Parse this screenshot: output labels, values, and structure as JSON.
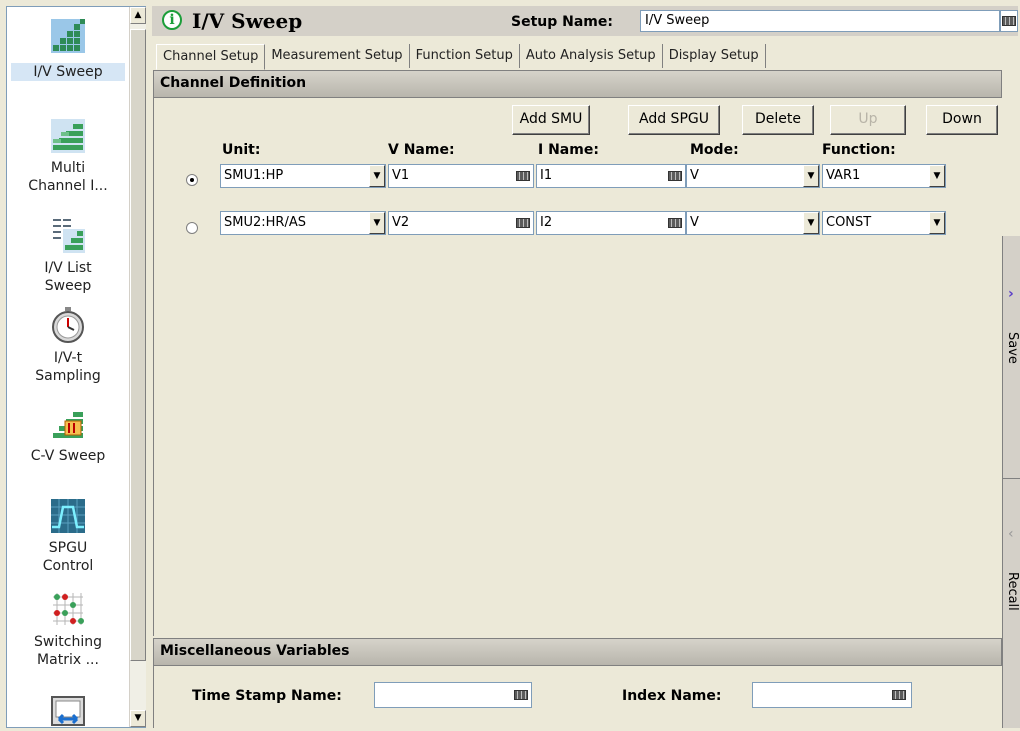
{
  "sidebar": {
    "items": [
      {
        "label_line1": "I/V Sweep",
        "label_line2": "",
        "icon": "iv-sweep-icon"
      },
      {
        "label_line1": "Multi",
        "label_line2": "Channel I...",
        "icon": "multi-channel-icon"
      },
      {
        "label_line1": "I/V List",
        "label_line2": "Sweep",
        "icon": "list-sweep-icon"
      },
      {
        "label_line1": "I/V-t",
        "label_line2": "Sampling",
        "icon": "stopwatch-icon"
      },
      {
        "label_line1": "C-V Sweep",
        "label_line2": "",
        "icon": "cv-sweep-icon"
      },
      {
        "label_line1": "SPGU",
        "label_line2": "Control",
        "icon": "spgu-icon"
      },
      {
        "label_line1": "Switching",
        "label_line2": "Matrix ...",
        "icon": "switching-matrix-icon"
      }
    ]
  },
  "header": {
    "title": "I/V Sweep",
    "setup_name_label": "Setup Name:",
    "setup_name_value": "I/V Sweep"
  },
  "tabs": [
    {
      "label": "Channel Setup",
      "active": true
    },
    {
      "label": "Measurement Setup",
      "active": false
    },
    {
      "label": "Function Setup",
      "active": false
    },
    {
      "label": "Auto Analysis Setup",
      "active": false
    },
    {
      "label": "Display Setup",
      "active": false
    }
  ],
  "channel_definition": {
    "title": "Channel Definition",
    "buttons": {
      "add_smu": "Add SMU",
      "add_spgu": "Add SPGU",
      "delete": "Delete",
      "up": "Up",
      "down": "Down"
    },
    "columns": {
      "unit": "Unit:",
      "v_name": "V Name:",
      "i_name": "I Name:",
      "mode": "Mode:",
      "function": "Function:"
    },
    "rows": [
      {
        "selected": true,
        "unit": "SMU1:HP",
        "v_name": "V1",
        "i_name": "I1",
        "mode": "V",
        "function": "VAR1"
      },
      {
        "selected": false,
        "unit": "SMU2:HR/AS",
        "v_name": "V2",
        "i_name": "I2",
        "mode": "V",
        "function": "CONST"
      }
    ]
  },
  "misc": {
    "title": "Miscellaneous Variables",
    "time_stamp_label": "Time Stamp Name:",
    "time_stamp_value": "",
    "index_label": "Index Name:",
    "index_value": ""
  },
  "right_panel": {
    "save_label": "Save",
    "recall_label": "Recall"
  }
}
